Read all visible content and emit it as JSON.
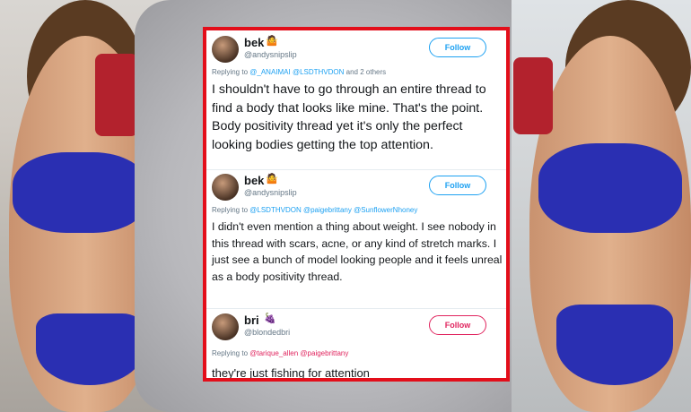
{
  "tweets": [
    {
      "name": "bek",
      "name_emoji": "🤷",
      "handle": "@andysnipslip",
      "follow_label": "Follow",
      "replying_prefix": "Replying to",
      "mentions": "@_ANAIMAI @LSDTHVDON",
      "replying_suffix": "and 2 others",
      "text": "I shouldn't have to go through an entire thread to find a body that looks like mine. That's the point. Body positivity thread yet it's only the perfect looking bodies getting the top attention."
    },
    {
      "name": "bek",
      "name_emoji": "🤷",
      "handle": "@andysnipslip",
      "follow_label": "Follow",
      "replying_prefix": "Replying to",
      "mentions": "@LSDTHVDON @paigebrittany @SunflowerNhoney",
      "text": "I didn't even mention a thing about weight. I see nobody in this thread with scars, acne, or any kind of stretch marks. I just see a bunch of model looking people and it feels unreal as a body positivity thread."
    },
    {
      "name": "bri",
      "name_emoji": "🍇",
      "handle": "@blondedbri",
      "follow_label": "Follow",
      "replying_prefix": "Replying to",
      "mentions": "@tarique_allen @paigebrittany",
      "text": "they're just fishing for attention"
    }
  ],
  "colors": {
    "accent_blue": "#1da1f2",
    "accent_pink": "#e0245e",
    "frame_red": "#e30e1a"
  }
}
